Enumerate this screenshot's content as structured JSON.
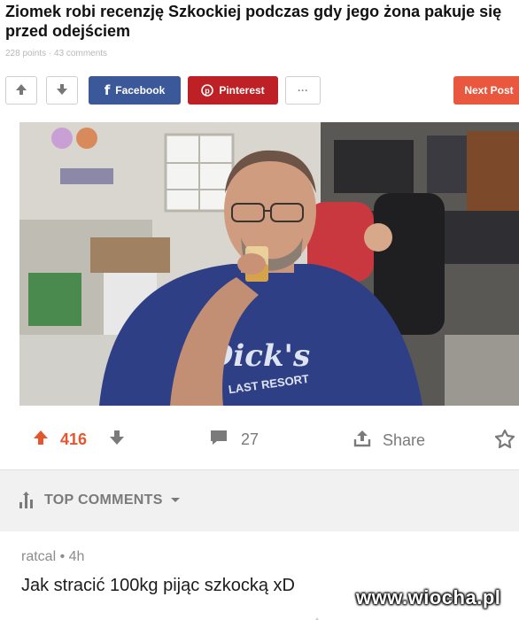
{
  "post": {
    "title": "Ziomek robi recenzję Szkockiej podczas gdy jego żona pakuje się przed odejściem",
    "meta": "228 points · 43 comments"
  },
  "toolbar": {
    "facebook_label": "Facebook",
    "pinterest_label": "Pinterest",
    "more_label": "···",
    "next_label": "Next Post"
  },
  "photo": {
    "shirt_text": "Dick's",
    "shirt_subtext": "LAST RESORT"
  },
  "actions": {
    "upvotes": "416",
    "comments": "27",
    "share_label": "Share"
  },
  "top_comments": {
    "label": "TOP COMMENTS"
  },
  "comment": {
    "user": "ratcal • 4h",
    "text": "Jak stracić 100kg pijąc szkocką xD"
  },
  "watermark": "www.wiocha.pl",
  "colors": {
    "facebook": "#3b5998",
    "pinterest": "#bd2125",
    "next": "#e9573e",
    "upvote": "#e7552f"
  }
}
